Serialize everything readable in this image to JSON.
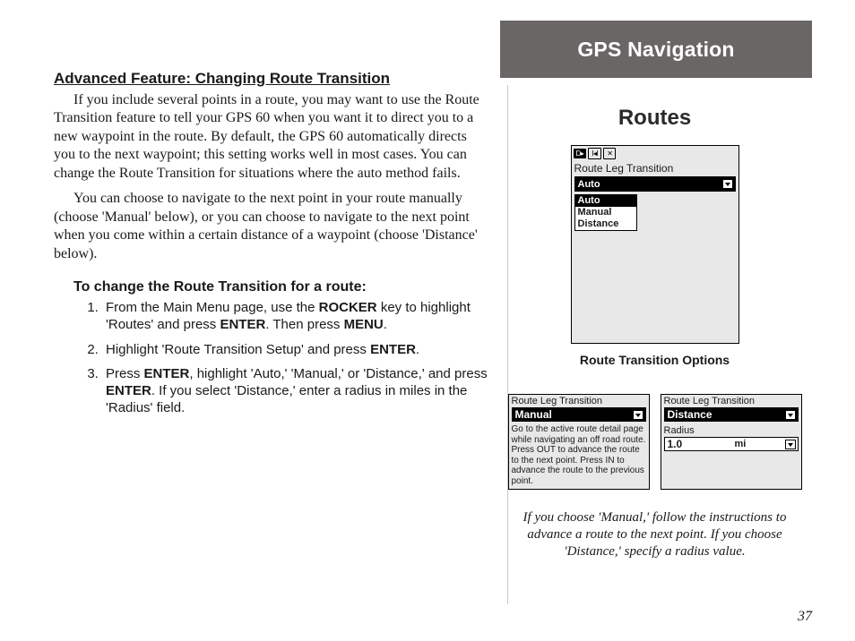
{
  "header": {
    "section": "GPS Navigation",
    "title": "Routes"
  },
  "left": {
    "featureTitle": "Advanced Feature: Changing Route Transition",
    "para1": "If you include several points in a route, you may want to use the Route Transition feature to tell your GPS 60 when you want it to direct you to a new waypoint in the route. By default, the GPS 60 automatically directs you to the next waypoint; this setting works well in most cases. You can change the Route Transition for situations where the auto method fails.",
    "para2": "You can choose to navigate to the next point in your route manually (choose 'Manual' below), or you can choose to navigate to the next point when you come within a certain distance of a waypoint (choose 'Distance' below).",
    "stepsTitle": "To change the Route Transition for a route:",
    "step1_a": "From the Main Menu page, use the ",
    "step1_b": "ROCKER",
    "step1_c": " key to highlight 'Routes' and press ",
    "step1_d": "ENTER",
    "step1_e": ". Then press ",
    "step1_f": "MENU",
    "step1_g": ".",
    "step2_a": "Highlight 'Route Transition Setup' and press ",
    "step2_b": "ENTER",
    "step2_c": ".",
    "step3_a": "Press ",
    "step3_b": "ENTER",
    "step3_c": ", highlight 'Auto,' 'Manual,' or 'Distance,' and press ",
    "step3_d": "ENTER",
    "step3_e": ". If you select 'Distance,' enter a radius in miles in the 'Radius' field."
  },
  "fig1": {
    "label": "Route Leg Transition",
    "selected": "Auto",
    "options": {
      "o1": "Auto",
      "o2": "Manual",
      "o3": "Distance"
    },
    "caption": "Route Transition Options",
    "iconLabel": "D▸"
  },
  "fig2": {
    "label": "Route Leg Transition",
    "selected": "Manual",
    "desc": "Go to the active route detail page while navigating an off road route.  Press OUT to advance the route to the next point. Press IN to advance the route to the previous point."
  },
  "fig3": {
    "label": "Route Leg Transition",
    "selected": "Distance",
    "radiusLabel": "Radius",
    "radiusValue": "1.0",
    "radiusUnit": "mi"
  },
  "italicCaption": "If you choose 'Manual,' follow the instructions to advance a route to the next point. If you choose 'Distance,' specify a radius value.",
  "pageNumber": "37"
}
